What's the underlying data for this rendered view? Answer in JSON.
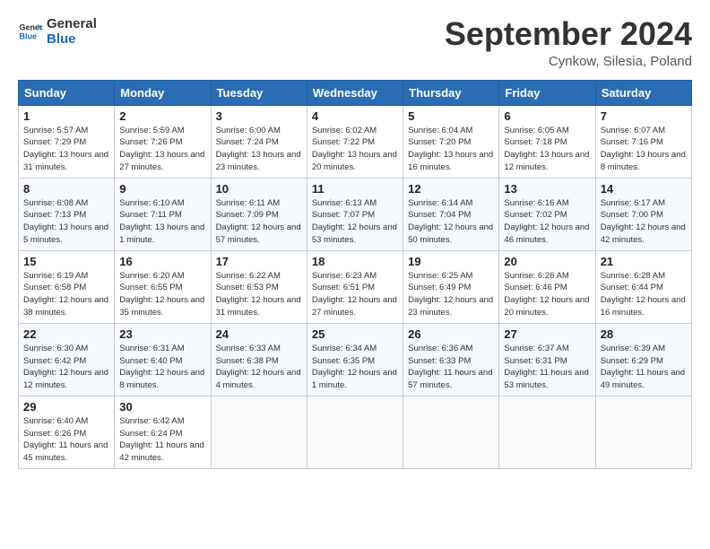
{
  "logo": {
    "line1": "General",
    "line2": "Blue"
  },
  "title": "September 2024",
  "subtitle": "Cynkow, Silesia, Poland",
  "days_header": [
    "Sunday",
    "Monday",
    "Tuesday",
    "Wednesday",
    "Thursday",
    "Friday",
    "Saturday"
  ],
  "weeks": [
    [
      {
        "day": "1",
        "sunrise": "5:57 AM",
        "sunset": "7:29 PM",
        "daylight": "13 hours and 31 minutes."
      },
      {
        "day": "2",
        "sunrise": "5:59 AM",
        "sunset": "7:26 PM",
        "daylight": "13 hours and 27 minutes."
      },
      {
        "day": "3",
        "sunrise": "6:00 AM",
        "sunset": "7:24 PM",
        "daylight": "13 hours and 23 minutes."
      },
      {
        "day": "4",
        "sunrise": "6:02 AM",
        "sunset": "7:22 PM",
        "daylight": "13 hours and 20 minutes."
      },
      {
        "day": "5",
        "sunrise": "6:04 AM",
        "sunset": "7:20 PM",
        "daylight": "13 hours and 16 minutes."
      },
      {
        "day": "6",
        "sunrise": "6:05 AM",
        "sunset": "7:18 PM",
        "daylight": "13 hours and 12 minutes."
      },
      {
        "day": "7",
        "sunrise": "6:07 AM",
        "sunset": "7:16 PM",
        "daylight": "13 hours and 8 minutes."
      }
    ],
    [
      {
        "day": "8",
        "sunrise": "6:08 AM",
        "sunset": "7:13 PM",
        "daylight": "13 hours and 5 minutes."
      },
      {
        "day": "9",
        "sunrise": "6:10 AM",
        "sunset": "7:11 PM",
        "daylight": "13 hours and 1 minute."
      },
      {
        "day": "10",
        "sunrise": "6:11 AM",
        "sunset": "7:09 PM",
        "daylight": "12 hours and 57 minutes."
      },
      {
        "day": "11",
        "sunrise": "6:13 AM",
        "sunset": "7:07 PM",
        "daylight": "12 hours and 53 minutes."
      },
      {
        "day": "12",
        "sunrise": "6:14 AM",
        "sunset": "7:04 PM",
        "daylight": "12 hours and 50 minutes."
      },
      {
        "day": "13",
        "sunrise": "6:16 AM",
        "sunset": "7:02 PM",
        "daylight": "12 hours and 46 minutes."
      },
      {
        "day": "14",
        "sunrise": "6:17 AM",
        "sunset": "7:00 PM",
        "daylight": "12 hours and 42 minutes."
      }
    ],
    [
      {
        "day": "15",
        "sunrise": "6:19 AM",
        "sunset": "6:58 PM",
        "daylight": "12 hours and 38 minutes."
      },
      {
        "day": "16",
        "sunrise": "6:20 AM",
        "sunset": "6:55 PM",
        "daylight": "12 hours and 35 minutes."
      },
      {
        "day": "17",
        "sunrise": "6:22 AM",
        "sunset": "6:53 PM",
        "daylight": "12 hours and 31 minutes."
      },
      {
        "day": "18",
        "sunrise": "6:23 AM",
        "sunset": "6:51 PM",
        "daylight": "12 hours and 27 minutes."
      },
      {
        "day": "19",
        "sunrise": "6:25 AM",
        "sunset": "6:49 PM",
        "daylight": "12 hours and 23 minutes."
      },
      {
        "day": "20",
        "sunrise": "6:26 AM",
        "sunset": "6:46 PM",
        "daylight": "12 hours and 20 minutes."
      },
      {
        "day": "21",
        "sunrise": "6:28 AM",
        "sunset": "6:44 PM",
        "daylight": "12 hours and 16 minutes."
      }
    ],
    [
      {
        "day": "22",
        "sunrise": "6:30 AM",
        "sunset": "6:42 PM",
        "daylight": "12 hours and 12 minutes."
      },
      {
        "day": "23",
        "sunrise": "6:31 AM",
        "sunset": "6:40 PM",
        "daylight": "12 hours and 8 minutes."
      },
      {
        "day": "24",
        "sunrise": "6:33 AM",
        "sunset": "6:38 PM",
        "daylight": "12 hours and 4 minutes."
      },
      {
        "day": "25",
        "sunrise": "6:34 AM",
        "sunset": "6:35 PM",
        "daylight": "12 hours and 1 minute."
      },
      {
        "day": "26",
        "sunrise": "6:36 AM",
        "sunset": "6:33 PM",
        "daylight": "11 hours and 57 minutes."
      },
      {
        "day": "27",
        "sunrise": "6:37 AM",
        "sunset": "6:31 PM",
        "daylight": "11 hours and 53 minutes."
      },
      {
        "day": "28",
        "sunrise": "6:39 AM",
        "sunset": "6:29 PM",
        "daylight": "11 hours and 49 minutes."
      }
    ],
    [
      {
        "day": "29",
        "sunrise": "6:40 AM",
        "sunset": "6:26 PM",
        "daylight": "11 hours and 45 minutes."
      },
      {
        "day": "30",
        "sunrise": "6:42 AM",
        "sunset": "6:24 PM",
        "daylight": "11 hours and 42 minutes."
      },
      null,
      null,
      null,
      null,
      null
    ]
  ]
}
